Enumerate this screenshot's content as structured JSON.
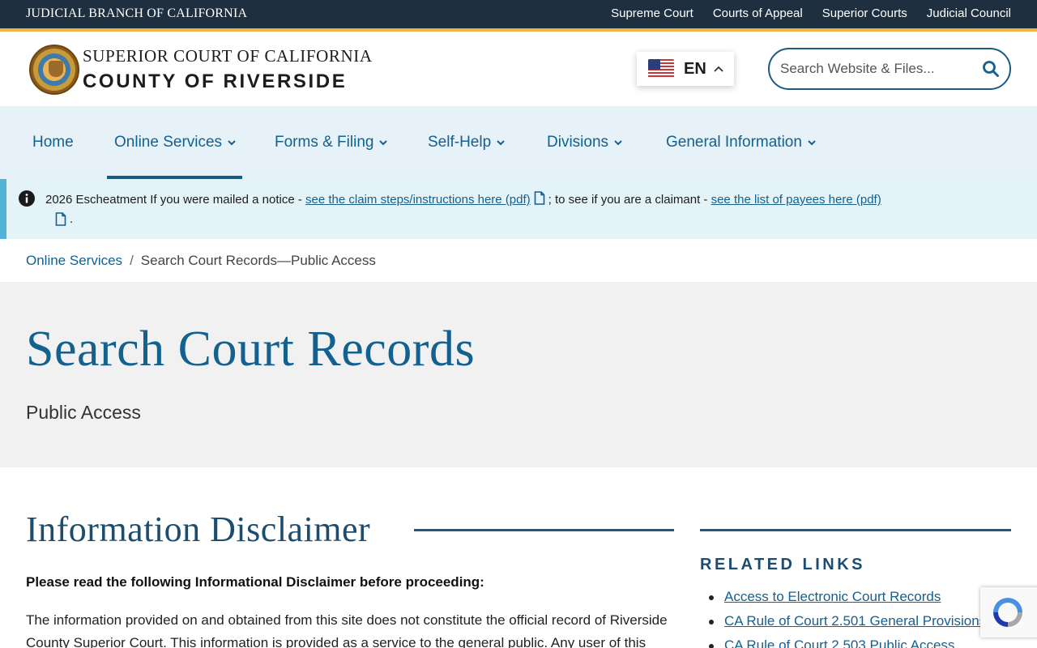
{
  "topbar": {
    "branch": "JUDICIAL BRANCH OF CALIFORNIA",
    "links": [
      "Supreme Court",
      "Courts of Appeal",
      "Superior Courts",
      "Judicial Council"
    ]
  },
  "header": {
    "logo_line1": "SUPERIOR COURT OF CALIFORNIA",
    "logo_line2": "COUNTY OF RIVERSIDE",
    "language": {
      "code": "EN",
      "flag": "us-flag-icon"
    },
    "search_placeholder": "Search Website & Files..."
  },
  "nav": {
    "items": [
      "Home",
      "Online Services",
      "Forms & Filing",
      "Self-Help",
      "Divisions",
      "General Information"
    ],
    "active": "Online Services"
  },
  "alert": {
    "title": "2026 Escheatment",
    "text1": "If you were mailed a notice -",
    "link1": "see the claim steps/instructions here (pdf)",
    "text2": "; to see if you are a claimant -",
    "link2": "see the list of payees here (pdf)",
    "end": "."
  },
  "breadcrumb": {
    "parent": "Online Services",
    "separator": "/",
    "current": "Search Court Records—Public Access"
  },
  "hero": {
    "title": "Search Court Records",
    "subtitle": "Public Access"
  },
  "main": {
    "heading": "Information Disclaimer",
    "lead": "Please read the following Informational Disclaimer before proceeding:",
    "body": "The information provided on and obtained from this site does not constitute the official record of Riverside County Superior Court. This information is provided as a service to the general public. Any user of this"
  },
  "sidebar": {
    "heading": "RELATED LINKS",
    "links": [
      "Access to Electronic Court Records",
      "CA Rule of Court 2.501 General Provisions",
      "CA Rule of Court 2.503 Public Access"
    ]
  },
  "colors": {
    "topbar_bg": "#1e3040",
    "accent_gold": "#f2b33d",
    "link_blue": "#14608f",
    "nav_bg": "#e6f1f8",
    "alert_bg": "#e3f3f7",
    "hero_bg": "#f1f1f1"
  }
}
